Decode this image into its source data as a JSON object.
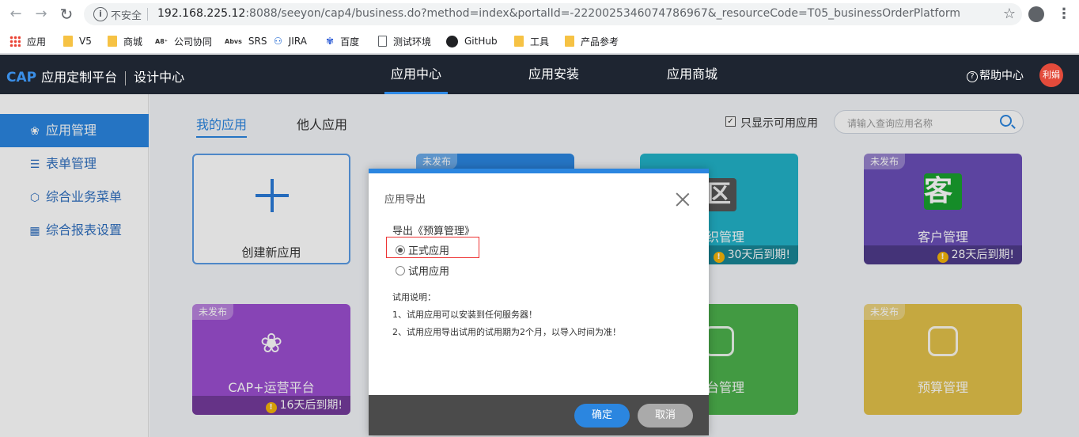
{
  "browser": {
    "insecure_label": "不安全",
    "url_host": "192.168.225.12",
    "url_rest": ":8088/seeyon/cap4/business.do?method=index&portalId=-2220025346074786967&_resourceCode=T05_businessOrderPlatform",
    "bookmarks": [
      "应用",
      "V5",
      "商城",
      "公司协同",
      "SRS",
      "JIRA",
      "百度",
      "测试环境",
      "GitHub",
      "工具",
      "产品参考"
    ]
  },
  "header": {
    "brand_cap": "CAP",
    "brand_name": "应用定制平台",
    "brand_sub": "设计中心",
    "nav": [
      "应用中心",
      "应用安装",
      "应用商城"
    ],
    "help": "帮助中心",
    "avatar": "利娟"
  },
  "sidebar": {
    "items": [
      {
        "label": "应用管理",
        "icon": "grid-icon"
      },
      {
        "label": "表单管理",
        "icon": "layers-icon"
      },
      {
        "label": "综合业务菜单",
        "icon": "cube-icon"
      },
      {
        "label": "综合报表设置",
        "icon": "report-icon"
      }
    ]
  },
  "main": {
    "tabs": [
      "我的应用",
      "他人应用"
    ],
    "only_available": "只显示可用应用",
    "only_available_checked": true,
    "search_placeholder": "请输入查询应用名称",
    "create_label": "创建新应用",
    "cards": [
      {
        "title": "",
        "badge": "未发布",
        "color": "#2b86e0",
        "expire": ""
      },
      {
        "title": "组织管理",
        "badge": "",
        "color": "#22b3c8",
        "expire": "30天后到期!",
        "icon": "区"
      },
      {
        "title": "客户管理",
        "badge": "未发布",
        "color": "#6a4fb8",
        "expire": "28天后到期!",
        "icon": "客"
      },
      {
        "title": "CAP+运营平台",
        "badge": "未发布",
        "color": "#9b4fd0",
        "expire": "16天后到期!"
      },
      {
        "title": "平台管理",
        "badge": "",
        "color": "#4cb14c",
        "expire": ""
      },
      {
        "title": "预算管理",
        "badge": "未发布",
        "color": "#e3c14a",
        "expire": ""
      }
    ]
  },
  "dialog": {
    "title": "应用导出",
    "heading": "导出《预算管理》",
    "options": [
      "正式应用",
      "试用应用"
    ],
    "selected": "正式应用",
    "notes": [
      "试用说明：",
      "1、试用应用可以安装到任何服务器！",
      "2、试用应用导出试用的试用期为2个月，以导入时间为准！"
    ],
    "ok": "确定",
    "cancel": "取消"
  }
}
